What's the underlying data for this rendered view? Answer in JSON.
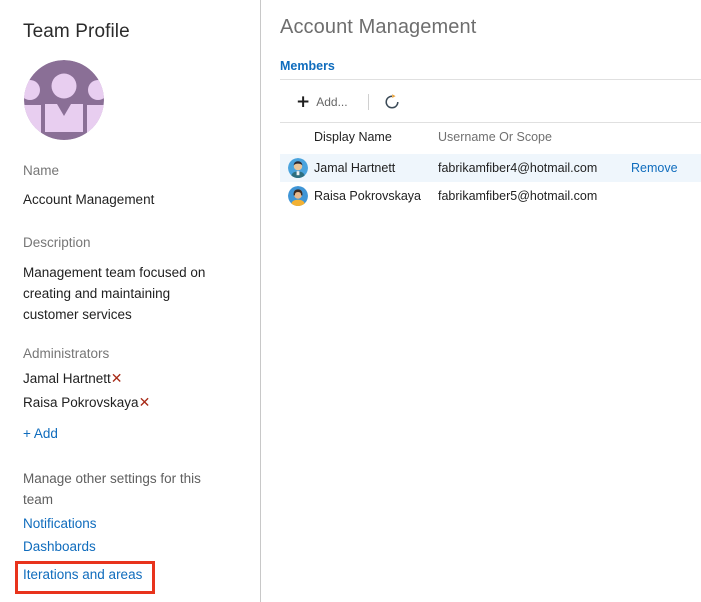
{
  "left": {
    "title": "Team Profile",
    "avatar_icon": "team-avatar-icon",
    "name_label": "Name",
    "name_value": "Account Management",
    "description_label": "Description",
    "description_value": "Management team focused on creating and maintaining customer services",
    "administrators_label": "Administrators",
    "administrators": [
      {
        "name": "Jamal Hartnett",
        "remove_icon": "✕"
      },
      {
        "name": "Raisa Pokrovskaya",
        "remove_icon": "✕"
      }
    ],
    "add_admin_label": "+ Add",
    "manage_text": "Manage other settings for this team",
    "settings_links": [
      {
        "label": "Notifications"
      },
      {
        "label": "Dashboards"
      }
    ],
    "highlighted_link": {
      "label": "Iterations and areas"
    },
    "highlight_color": "#e8331c"
  },
  "right": {
    "page_title": "Account Management",
    "tabs": [
      {
        "label": "Members",
        "active": true
      }
    ],
    "toolbar": {
      "add_icon": "+",
      "add_label": "Add...",
      "refresh_icon": "refresh-icon"
    },
    "table": {
      "columns": [
        "Display Name",
        "Username Or Scope",
        ""
      ],
      "rows": [
        {
          "display_name": "Jamal Hartnett",
          "username": "fabrikamfiber4@hotmail.com",
          "action": "Remove",
          "selected": true,
          "avatar": "jamal-avatar"
        },
        {
          "display_name": "Raisa Pokrovskaya",
          "username": "fabrikamfiber5@hotmail.com",
          "action": "",
          "selected": false,
          "avatar": "raisa-avatar"
        }
      ]
    }
  },
  "colors": {
    "link": "#0f6cbd",
    "accent_red": "#a82b18",
    "highlight": "#e8331c",
    "row_selected": "#eff6fc",
    "avatar_purple_dark": "#8a6f96",
    "avatar_purple_light": "#e8cef0"
  }
}
